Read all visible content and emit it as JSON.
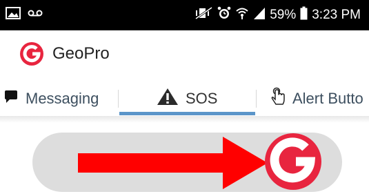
{
  "status_bar": {
    "icons_left": [
      "image-icon",
      "voicemail-icon"
    ],
    "icons_right": [
      "mute-vibrate-icon",
      "alarm-icon",
      "wifi-icon",
      "signal-icon",
      "battery-icon"
    ],
    "battery": "59%",
    "time": "3:23 PM"
  },
  "app": {
    "title": "GeoPro",
    "brand_color": "#e8253f"
  },
  "tabs": [
    {
      "label": "Messaging",
      "icon": "chat-icon"
    },
    {
      "label": "SOS",
      "icon": "warning-icon",
      "active": true
    },
    {
      "label": "Alert Butto",
      "icon": "touch-icon"
    }
  ],
  "slider": {
    "arrow_color": "#ff0000",
    "knob_icon": "geopro-logo-icon",
    "track_color": "#dddddd"
  }
}
